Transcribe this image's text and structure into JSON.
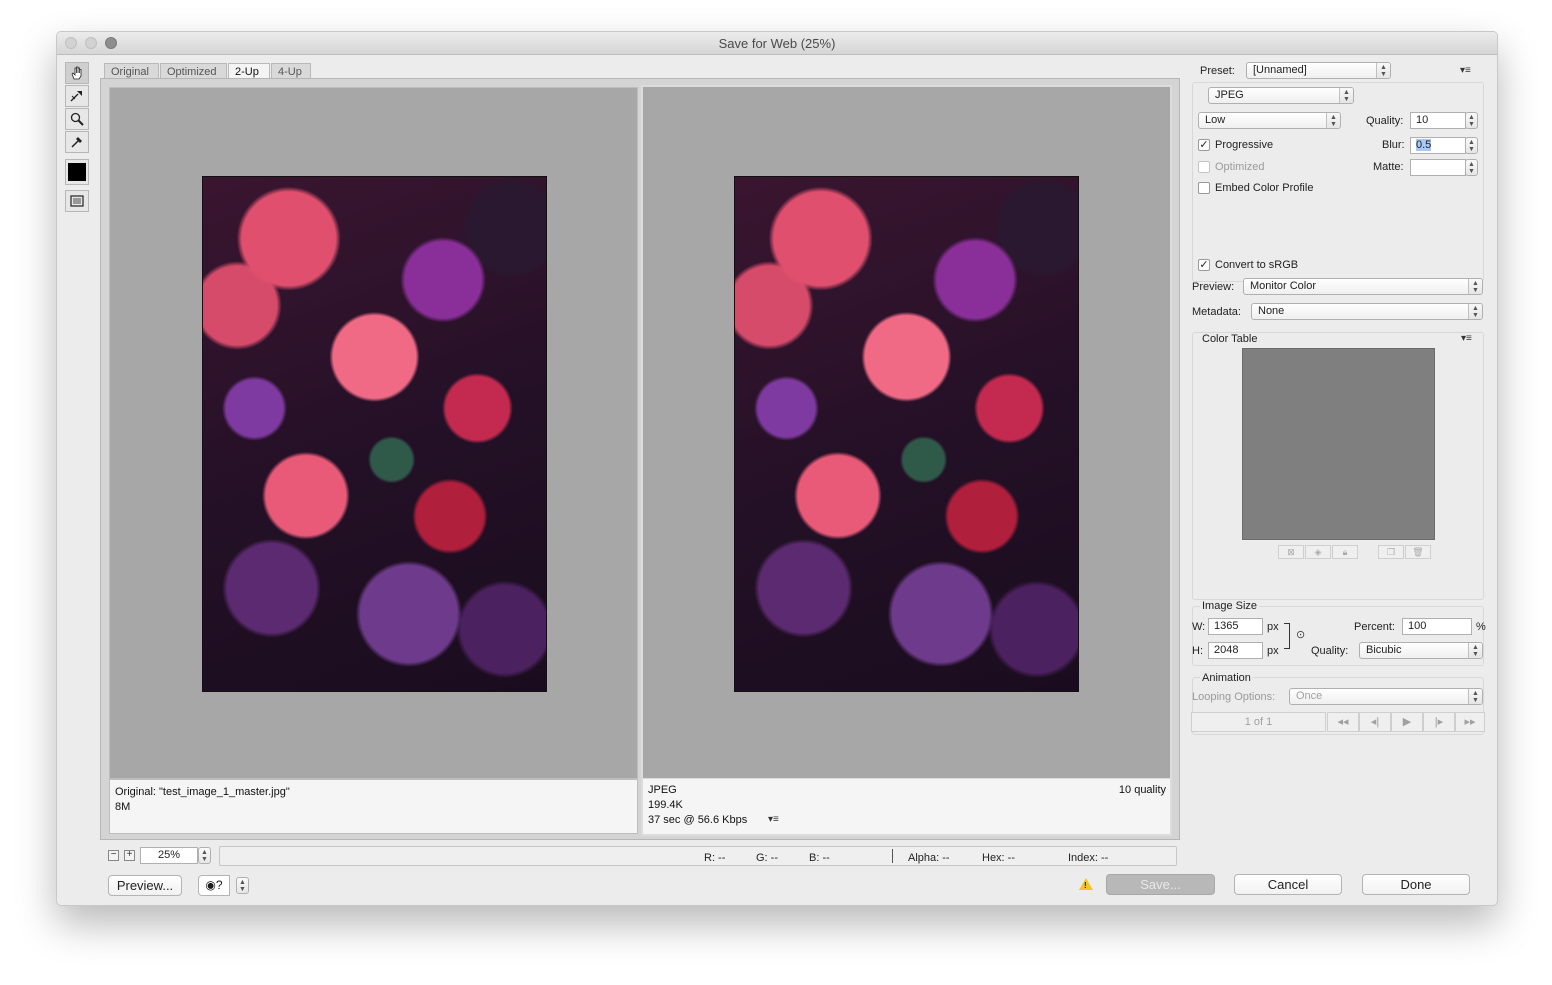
{
  "window": {
    "title": "Save for Web (25%)"
  },
  "tabs": [
    "Original",
    "Optimized",
    "2-Up",
    "4-Up"
  ],
  "tools": [
    "hand-tool-icon",
    "slice-select-tool-icon",
    "zoom-tool-icon",
    "eyedropper-tool-icon",
    "eyedropper-color-swatch",
    "toggle-slices-icon"
  ],
  "left_pane": {
    "line1": "Original: \"test_image_1_master.jpg\"",
    "line2": "8M"
  },
  "right_pane": {
    "format": "JPEG",
    "size": "199.4K",
    "time": "37 sec @ 56.6 Kbps",
    "quality_note": "10 quality"
  },
  "settings": {
    "preset_label": "Preset:",
    "preset_value": "[Unnamed]",
    "format_value": "JPEG",
    "compression_value": "Low",
    "quality_label": "Quality:",
    "quality_value": "10",
    "progressive_label": "Progressive",
    "progressive_checked": true,
    "blur_label": "Blur:",
    "blur_value": "0.5",
    "optimized_label": "Optimized",
    "optimized_checked": false,
    "matte_label": "Matte:",
    "embed_label": "Embed Color Profile",
    "embed_checked": false,
    "srgb_label": "Convert to sRGB",
    "srgb_checked": true,
    "preview_label": "Preview:",
    "preview_value": "Monitor Color",
    "metadata_label": "Metadata:",
    "metadata_value": "None"
  },
  "color_table": {
    "label": "Color Table"
  },
  "image_size": {
    "label": "Image Size",
    "w_label": "W:",
    "w_value": "1365",
    "h_label": "H:",
    "h_value": "2048",
    "unit": "px",
    "percent_label": "Percent:",
    "percent_value": "100",
    "percent_unit": "%",
    "quality_label": "Quality:",
    "quality_value": "Bicubic"
  },
  "animation": {
    "label": "Animation",
    "looping_label": "Looping Options:",
    "looping_value": "Once",
    "frame_counter": "1 of 1"
  },
  "statusbar": {
    "zoom_value": "25%",
    "r": "R: --",
    "g": "G: --",
    "b": "B: --",
    "alpha": "Alpha: --",
    "hex": "Hex: --",
    "index": "Index: --"
  },
  "buttons": {
    "preview": "Preview...",
    "save": "Save...",
    "cancel": "Cancel",
    "done": "Done"
  },
  "colors": {
    "window_bg": "#ececec",
    "pane_bg": "#a7a7a7",
    "warning": "#f3c623"
  }
}
